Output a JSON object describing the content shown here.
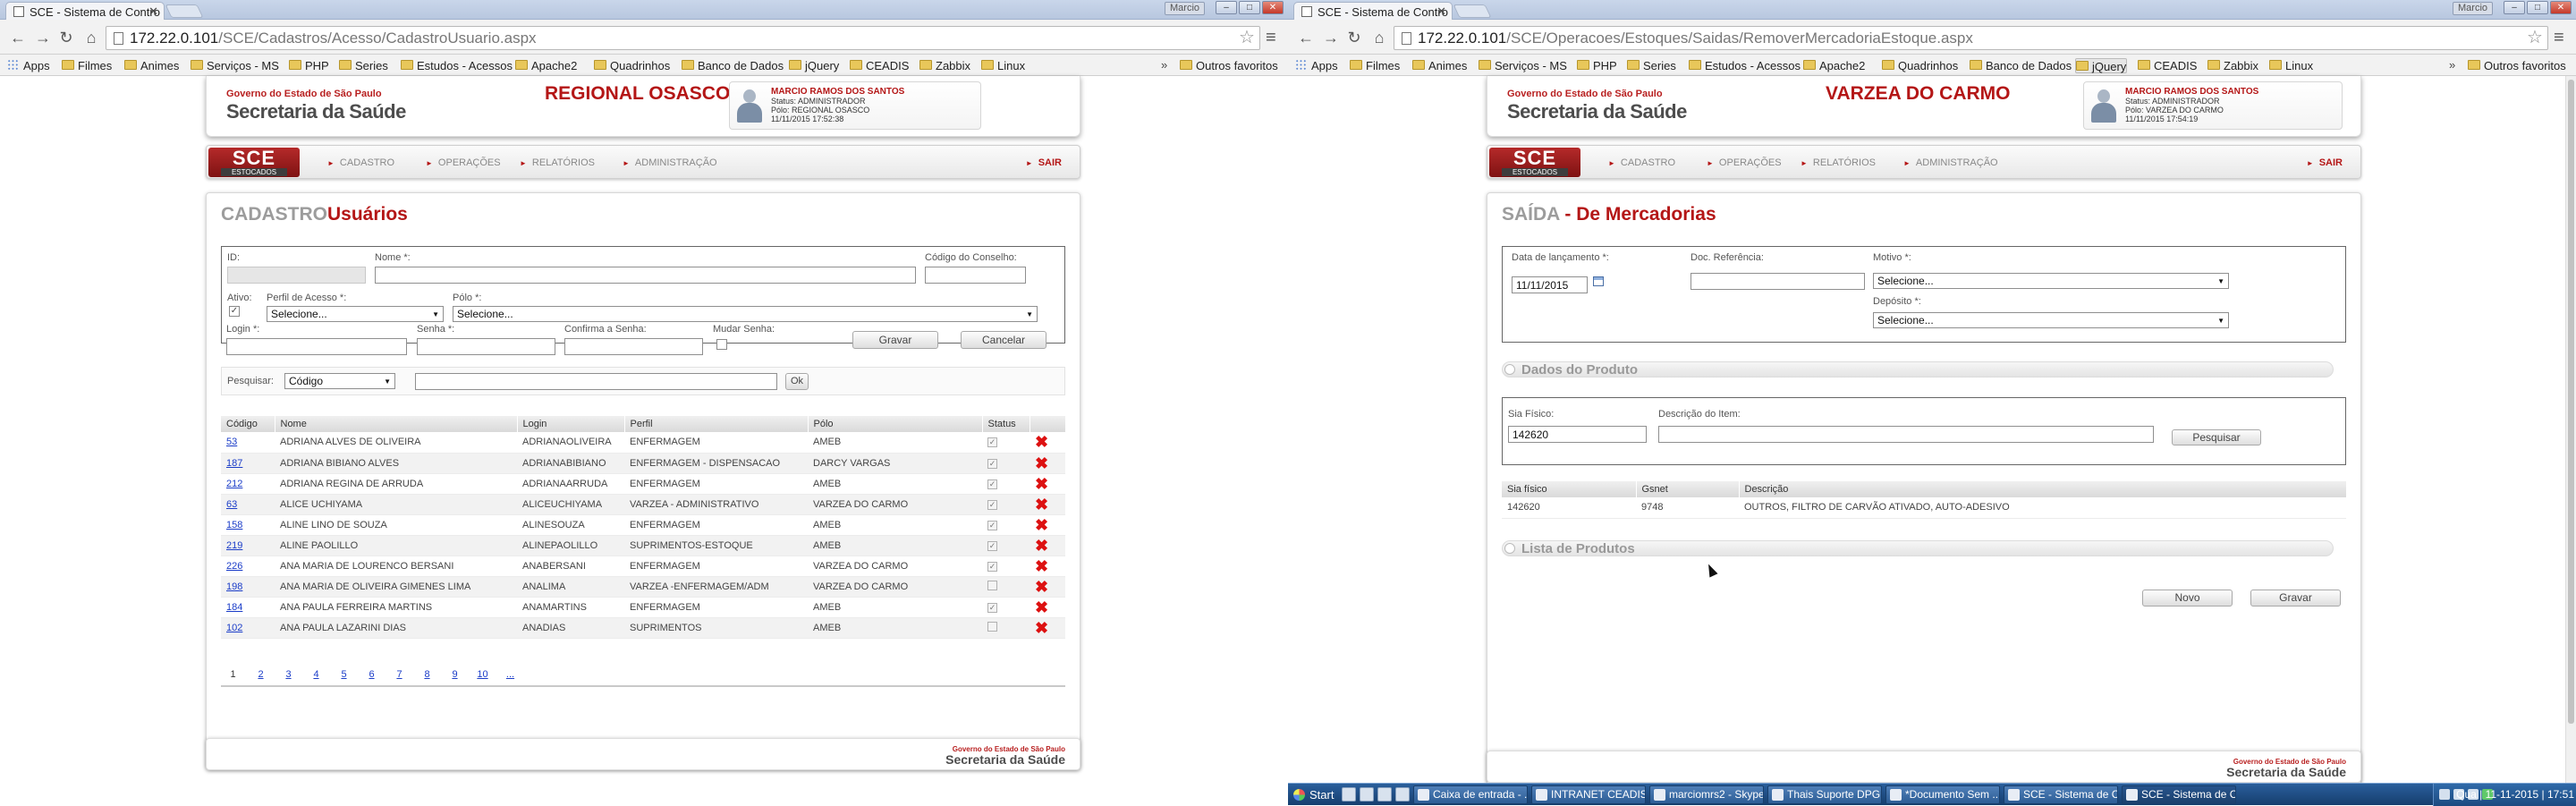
{
  "left": {
    "window": {
      "tab_title": "SCE - Sistema de Contro",
      "user_button": "Marcio",
      "url_host": "172.22.0.101",
      "url_path": "/SCE/Cadastros/Acesso/CadastroUsuario.aspx"
    },
    "bookmarks": [
      "Apps",
      "Filmes",
      "Animes",
      "Serviços - MS",
      "PHP",
      "Series",
      "Estudos - Acessos",
      "Apache2",
      "Quadrinhos",
      "Banco de Dados",
      "jQuery",
      "CEADIS",
      "Zabbix",
      "Linux"
    ],
    "bookmarks_more": "»",
    "bookmarks_other": "Outros favoritos",
    "header": {
      "gov": "Governo do Estado de São Paulo",
      "secretaria": "Secretaria da Saúde",
      "region": "REGIONAL OSASCO",
      "user_name": "MARCIO RAMOS DOS SANTOS",
      "user_status": "Status: ADMINISTRADOR",
      "user_polo": "Pólo: REGIONAL OSASCO",
      "user_time": "11/11/2015 17:52:38"
    },
    "menu": {
      "logo": "SCE",
      "logo_sub": "ESTOCADOS",
      "items": [
        "CADASTRO",
        "OPERAÇÕES",
        "RELATÓRIOS",
        "ADMINISTRAÇÃO"
      ],
      "logout": "SAIR"
    },
    "title_gray": "CADASTRO",
    "title_red": "Usuários",
    "form": {
      "id_label": "ID:",
      "nome_label": "Nome *:",
      "codigo_label": "Código do Conselho:",
      "ativo_label": "Ativo:",
      "perfil_label": "Perfil de Acesso *:",
      "perfil_value": "Selecione...",
      "polo_label": "Pólo *:",
      "polo_value": "Selecione...",
      "login_label": "Login *:",
      "senha_label": "Senha *:",
      "confirma_label": "Confirma a Senha:",
      "mudar_label": "Mudar Senha:",
      "gravar": "Gravar",
      "cancelar": "Cancelar"
    },
    "search": {
      "label": "Pesquisar:",
      "option": "Código",
      "ok": "Ok"
    },
    "table": {
      "headers": [
        "Código",
        "Nome",
        "Login",
        "Perfil",
        "Pólo",
        "Status"
      ],
      "rows": [
        {
          "codigo": "53",
          "nome": "ADRIANA ALVES DE OLIVEIRA",
          "login": "ADRIANAOLIVEIRA",
          "perfil": "ENFERMAGEM",
          "polo": "AMEB",
          "status": true
        },
        {
          "codigo": "187",
          "nome": "ADRIANA BIBIANO ALVES",
          "login": "ADRIANABIBIANO",
          "perfil": "ENFERMAGEM - DISPENSACAO",
          "polo": "DARCY VARGAS",
          "status": true
        },
        {
          "codigo": "212",
          "nome": "ADRIANA REGINA DE ARRUDA",
          "login": "ADRIANAARRUDA",
          "perfil": "ENFERMAGEM",
          "polo": "AMEB",
          "status": true
        },
        {
          "codigo": "63",
          "nome": "ALICE UCHIYAMA",
          "login": "ALICEUCHIYAMA",
          "perfil": "VARZEA - ADMINISTRATIVO",
          "polo": "VARZEA DO CARMO",
          "status": true
        },
        {
          "codigo": "158",
          "nome": "ALINE LINO DE SOUZA",
          "login": "ALINESOUZA",
          "perfil": "ENFERMAGEM",
          "polo": "AMEB",
          "status": true
        },
        {
          "codigo": "219",
          "nome": "ALINE PAOLILLO",
          "login": "ALINEPAOLILLO",
          "perfil": "SUPRIMENTOS-ESTOQUE",
          "polo": "AMEB",
          "status": true
        },
        {
          "codigo": "226",
          "nome": "ANA MARIA DE LOURENCO BERSANI",
          "login": "ANABERSANI",
          "perfil": "ENFERMAGEM",
          "polo": "VARZEA DO CARMO",
          "status": true
        },
        {
          "codigo": "198",
          "nome": "ANA MARIA DE OLIVEIRA GIMENES LIMA",
          "login": "ANALIMA",
          "perfil": "VARZEA -ENFERMAGEM/ADM",
          "polo": "VARZEA DO CARMO",
          "status": false
        },
        {
          "codigo": "184",
          "nome": "ANA PAULA FERREIRA MARTINS",
          "login": "ANAMARTINS",
          "perfil": "ENFERMAGEM",
          "polo": "AMEB",
          "status": true
        },
        {
          "codigo": "102",
          "nome": "ANA PAULA LAZARINI DIAS",
          "login": "ANADIAS",
          "perfil": "SUPRIMENTOS",
          "polo": "AMEB",
          "status": false
        }
      ]
    },
    "pager": [
      "1",
      "2",
      "3",
      "4",
      "5",
      "6",
      "7",
      "8",
      "9",
      "10",
      "..."
    ],
    "footer": {
      "gov": "Governo do Estado de São Paulo",
      "secretaria": "Secretaria da Saúde"
    }
  },
  "right": {
    "window": {
      "tab_title": "SCE - Sistema de Contro",
      "user_button": "Marcio",
      "url_host": "172.22.0.101",
      "url_path": "/SCE/Operacoes/Estoques/Saidas/RemoverMercadoriaEstoque.aspx"
    },
    "bookmarks": [
      "Apps",
      "Filmes",
      "Animes",
      "Serviços - MS",
      "PHP",
      "Series",
      "Estudos - Acessos",
      "Apache2",
      "Quadrinhos",
      "Banco de Dados",
      "jQuery",
      "CEADIS",
      "Zabbix",
      "Linux"
    ],
    "bookmarks_more": "»",
    "bookmarks_other": "Outros favoritos",
    "header": {
      "gov": "Governo do Estado de São Paulo",
      "secretaria": "Secretaria da Saúde",
      "region": "VARZEA DO CARMO",
      "user_name": "MARCIO RAMOS DOS SANTOS",
      "user_status": "Status: ADMINISTRADOR",
      "user_polo": "Pólo: VARZEA DO CARMO",
      "user_time": "11/11/2015 17:54:19"
    },
    "menu": {
      "logo": "SCE",
      "logo_sub": "ESTOCADOS",
      "items": [
        "CADASTRO",
        "OPERAÇÕES",
        "RELATÓRIOS",
        "ADMINISTRAÇÃO"
      ],
      "logout": "SAIR"
    },
    "title_gray": "SAÍDA",
    "title_red": " - De Mercadorias",
    "form": {
      "data_label": "Data de lançamento *:",
      "data_value": "11/11/2015",
      "doc_label": "Doc. Referência:",
      "motivo_label": "Motivo *:",
      "motivo_value": "Selecione...",
      "deposito_label": "Depósito *:",
      "deposito_value": "Selecione..."
    },
    "produto_section": "Dados do Produto",
    "produto": {
      "sia_label": "Sia Físico:",
      "sia_value": "142620",
      "desc_label": "Descrição do Item:",
      "pesquisar": "Pesquisar"
    },
    "table": {
      "headers": [
        "Sia físico",
        "Gsnet",
        "Descrição"
      ],
      "rows": [
        {
          "sia": "142620",
          "gsnet": "9748",
          "descricao": "OUTROS, FILTRO DE CARVÃO ATIVADO, AUTO-ADESIVO"
        }
      ]
    },
    "lista_section": "Lista de Produtos",
    "novo": "Novo",
    "gravar": "Gravar",
    "footer": {
      "gov": "Governo do Estado de São Paulo",
      "secretaria": "Secretaria da Saúde"
    }
  },
  "taskbar": {
    "start": "Start",
    "items": [
      "Caixa de entrada - ...",
      "INTRANET CEADIS ...",
      "marciomrs2 - Skype™",
      "Thais Suporte DPG...",
      "*Documento Sem ...",
      "SCE - Sistema de C...",
      "SCE - Sistema de C..."
    ],
    "clock": "Qua | 11-11-2015 | 17:51"
  }
}
